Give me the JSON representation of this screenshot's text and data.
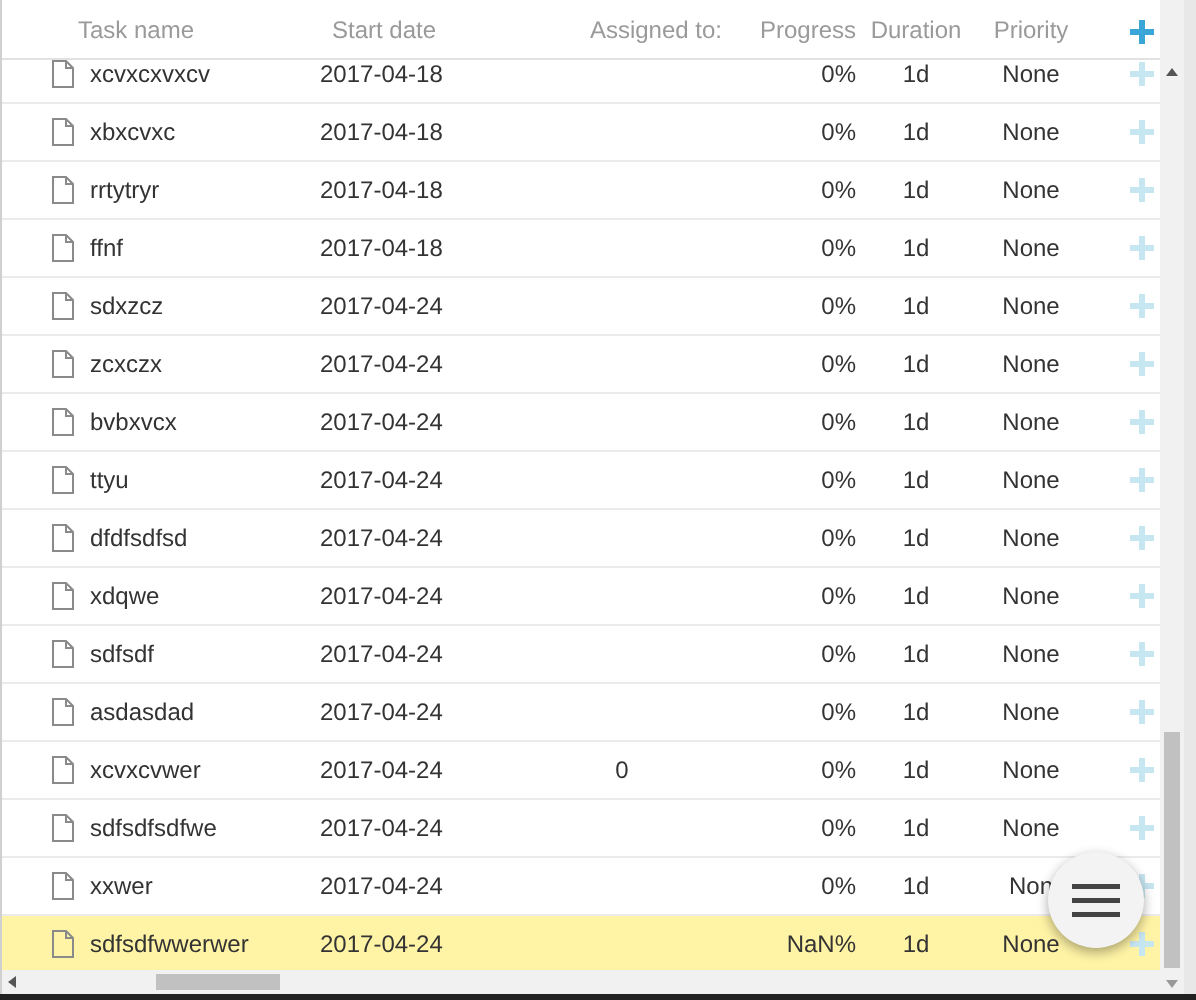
{
  "columns": [
    "Task name",
    "Start date",
    "Assigned to:",
    "Progress",
    "Duration",
    "Priority"
  ],
  "rows": [
    {
      "name": "xcvxcxvxcv",
      "start_date": "2017-04-18",
      "progress": "0%",
      "duration": "1d",
      "priority": "None",
      "selected": false
    },
    {
      "name": "xbxcvxc",
      "start_date": "2017-04-18",
      "progress": "0%",
      "duration": "1d",
      "priority": "None",
      "selected": false
    },
    {
      "name": "rrtytryr",
      "start_date": "2017-04-18",
      "progress": "0%",
      "duration": "1d",
      "priority": "None",
      "selected": false
    },
    {
      "name": "ffnf",
      "start_date": "2017-04-18",
      "progress": "0%",
      "duration": "1d",
      "priority": "None",
      "selected": false
    },
    {
      "name": "sdxzcz",
      "start_date": "2017-04-24",
      "progress": "0%",
      "duration": "1d",
      "priority": "None",
      "selected": false
    },
    {
      "name": "zcxczx",
      "start_date": "2017-04-24",
      "progress": "0%",
      "duration": "1d",
      "priority": "None",
      "selected": false
    },
    {
      "name": "bvbxvcx",
      "start_date": "2017-04-24",
      "progress": "0%",
      "duration": "1d",
      "priority": "None",
      "selected": false
    },
    {
      "name": "ttyu",
      "start_date": "2017-04-24",
      "progress": "0%",
      "duration": "1d",
      "priority": "None",
      "selected": false
    },
    {
      "name": "dfdfsdfsd",
      "start_date": "2017-04-24",
      "progress": "0%",
      "duration": "1d",
      "priority": "None",
      "selected": false
    },
    {
      "name": "xdqwe",
      "start_date": "2017-04-24",
      "progress": "0%",
      "duration": "1d",
      "priority": "None",
      "selected": false
    },
    {
      "name": "sdfsdf",
      "start_date": "2017-04-24",
      "progress": "0%",
      "duration": "1d",
      "priority": "None",
      "selected": false
    },
    {
      "name": "asdasdad",
      "start_date": "2017-04-24",
      "progress": "0%",
      "duration": "1d",
      "priority": "None",
      "selected": false
    },
    {
      "name": "xcvxcvwer",
      "start_date": "2017-04-24",
      "assigned": "0",
      "progress": "0%",
      "duration": "1d",
      "priority": "None",
      "selected": false
    },
    {
      "name": "sdfsdfsdfwe",
      "start_date": "2017-04-24",
      "progress": "0%",
      "duration": "1d",
      "priority": "None",
      "selected": false
    },
    {
      "name": "xxwer",
      "start_date": "2017-04-24",
      "progress": "0%",
      "duration": "1d",
      "priority": "Non",
      "selected": false
    },
    {
      "name": "sdfsdfwwerwer",
      "start_date": "2017-04-24",
      "progress": "NaN%",
      "duration": "1d",
      "priority": "None",
      "selected": true
    }
  ]
}
